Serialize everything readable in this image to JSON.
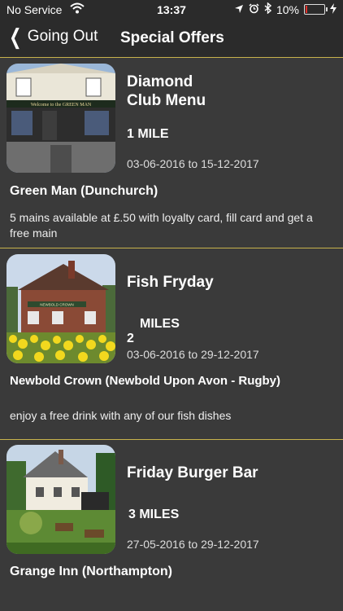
{
  "status_bar": {
    "carrier": "No Service",
    "time": "13:37",
    "battery": "10%",
    "battery_level": 0.1
  },
  "nav": {
    "back_label": "Going Out",
    "title": "Special Offers"
  },
  "offers": [
    {
      "title_line1": "Diamond",
      "title_line2": "Club Menu",
      "distance": "1 MILE",
      "dates": "03-06-2016 to 15-12-2017",
      "venue": "Green Man (Dunchurch)",
      "description": "5 mains available at £.50 with loyalty card, fill card and get a free main",
      "sign_text": "Welcome to the GREEN MAN"
    },
    {
      "title_line1": "Fish Fryday",
      "distance_number": "2",
      "distance_unit": "MILES",
      "dates": "03-06-2016 to 29-12-2017",
      "venue": "Newbold Crown (Newbold Upon Avon - Rugby)",
      "description": "enjoy a free drink with any of our fish dishes",
      "sign_text": "NEWBOLD CROWN"
    },
    {
      "title_line1": "Friday Burger Bar",
      "distance": "3 MILES",
      "dates": "27-05-2016 to 29-12-2017",
      "venue": "Grange Inn (Northampton)"
    }
  ]
}
